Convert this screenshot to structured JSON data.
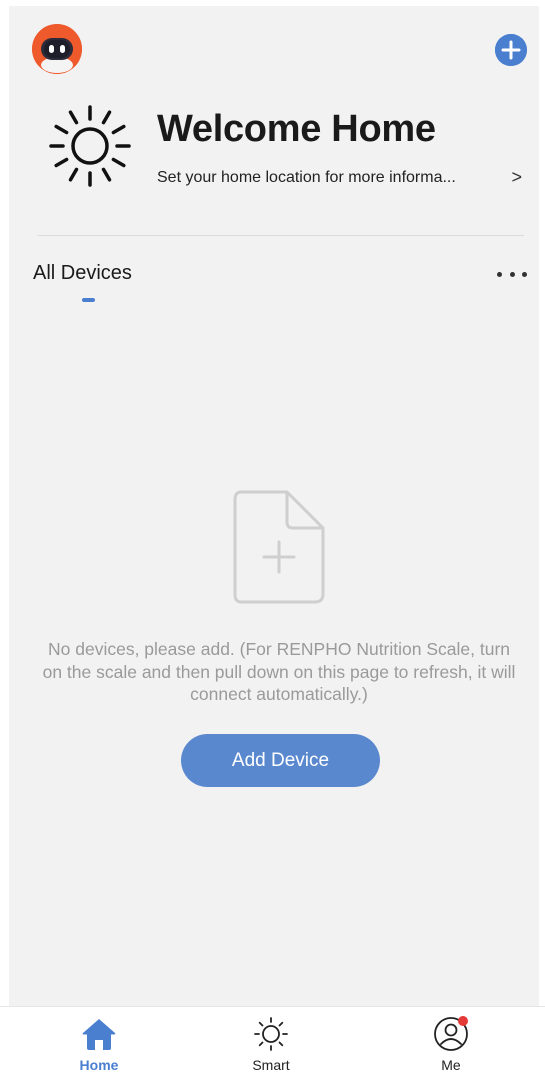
{
  "header": {
    "avatar_icon": "robot-avatar-icon",
    "add_icon": "plus-circle-icon"
  },
  "welcome": {
    "title": "Welcome Home",
    "subtitle": "Set your home location for more informa...",
    "chevron": ">"
  },
  "devices": {
    "section_title": "All Devices",
    "more_icon": "more-horizontal-icon",
    "empty_message": "No devices, please add. (For RENPHO Nutrition Scale, turn on the scale and then pull down on this page to refresh, it will connect automatically.)",
    "add_button_label": "Add Device"
  },
  "tabbar": {
    "tabs": [
      {
        "label": "Home",
        "icon": "home-icon",
        "active": true
      },
      {
        "label": "Smart",
        "icon": "sun-icon",
        "active": false
      },
      {
        "label": "Me",
        "icon": "user-icon",
        "active": false,
        "badge": true
      }
    ]
  },
  "colors": {
    "accent": "#4a7fd0",
    "button": "#5a88cf",
    "background": "#f2f2f2",
    "badge": "#e53935",
    "avatar": "#ee5a2b"
  }
}
